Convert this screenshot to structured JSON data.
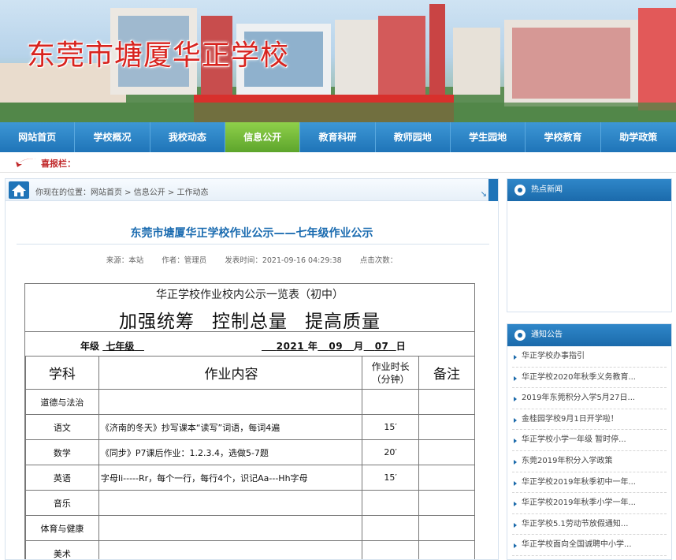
{
  "site": {
    "school_name": "东莞市塘厦华正学校"
  },
  "nav": {
    "items": [
      "网站首页",
      "学校概况",
      "我校动态",
      "信息公开",
      "教育科研",
      "教师园地",
      "学生园地",
      "学校教育",
      "助学政策"
    ],
    "active_index": 3
  },
  "ticker": {
    "label": "喜报栏："
  },
  "breadcrumb": {
    "text": "你现在的位置：网站首页 > 信息公开 > 工作动态"
  },
  "article": {
    "title": "东莞市塘厦华正学校作业公示——七年级作业公示",
    "source": "来源：本站",
    "author": "作者：管理员",
    "published": "发表时间：2021-09-16 04:29:38",
    "views": "点击次数："
  },
  "doc": {
    "title": "华正学校作业校内公示一览表（初中）",
    "slogan": [
      "加强统筹",
      "控制总量",
      "提高质量"
    ],
    "grade_label": "年级",
    "grade_value": "七年级",
    "date": {
      "year": "2021",
      "year_label": "年",
      "month": "09",
      "month_label": "月",
      "day": "07",
      "day_label": "日"
    },
    "headers": {
      "subject": "学科",
      "content": "作业内容",
      "duration_line1": "作业时长",
      "duration_line2": "（分钟）",
      "remark": "备注"
    },
    "rows": [
      {
        "subject": "道德与法治",
        "content": "",
        "duration": "",
        "remark": ""
      },
      {
        "subject": "语文",
        "content": "《济南的冬天》抄写课本“读写”词语，每词4遍",
        "duration": "15′",
        "remark": ""
      },
      {
        "subject": "数学",
        "content": "《同步》P7课后作业：1.2.3.4，选做5-7题",
        "duration": "20′",
        "remark": ""
      },
      {
        "subject": "英语",
        "content": "字母Ii-----Rr，每个一行，每行4个，识记Aa---Hh字母",
        "duration": "15′",
        "remark": ""
      },
      {
        "subject": "音乐",
        "content": "",
        "duration": "",
        "remark": ""
      },
      {
        "subject": "体育与健康",
        "content": "",
        "duration": "",
        "remark": ""
      },
      {
        "subject": "美术",
        "content": "",
        "duration": "",
        "remark": ""
      }
    ]
  },
  "sidebar": {
    "hot_news": {
      "title": "热点新闻"
    },
    "notices": {
      "title": "通知公告",
      "items": [
        "华正学校办事指引",
        "华正学校2020年秋季义务教育...",
        "2019年东莞积分入学5月27日...",
        "金桂园学校9月1日开学啦！",
        "华正学校小学一年级 暂时停...",
        "东莞2019年积分入学政策",
        "华正学校2019年秋季初中一年...",
        "华正学校2019年秋季小学一年...",
        "华正学校5.1劳动节放假通知...",
        "华正学校面向全国诚聘中小学..."
      ]
    }
  },
  "colors": {
    "nav": "#1f74b8",
    "nav_active": "#6cb536",
    "title_red": "#d8241f",
    "link_blue": "#1a6bb0"
  }
}
